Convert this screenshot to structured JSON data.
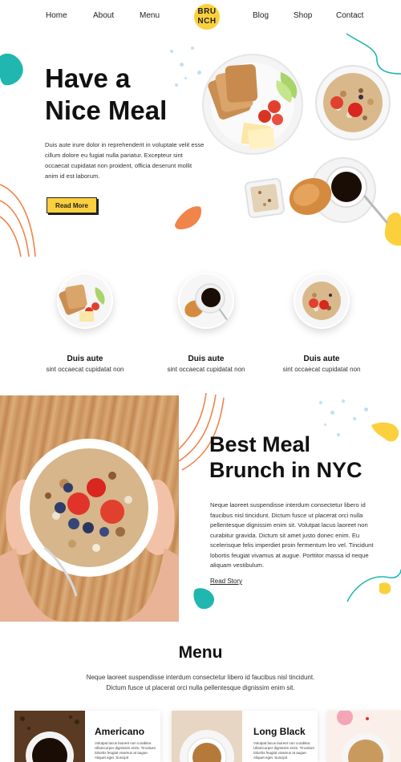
{
  "nav": {
    "items": [
      "Home",
      "About",
      "Menu",
      "Blog",
      "Shop",
      "Contact"
    ],
    "logo_line1": "BRU",
    "logo_line2": "NCH"
  },
  "hero": {
    "title_line1": "Have a",
    "title_line2": "Nice Meal",
    "text": "Duis aute irure dolor in reprehenderit in voluptate velit esse cillum dolore eu fugiat nulla pariatur. Excepteur sint occaecat cupidatat non proident, officia deserunt mollit anim id est laborum.",
    "button": "Read More"
  },
  "features": [
    {
      "title": "Duis aute",
      "sub": "sint occaecat cupidatat non",
      "icon": "toast-plate-icon"
    },
    {
      "title": "Duis aute",
      "sub": "sint occaecat cupidatat non",
      "icon": "coffee-cup-icon"
    },
    {
      "title": "Duis aute",
      "sub": "sint occaecat cupidatat non",
      "icon": "granola-bowl-icon"
    }
  ],
  "brunch": {
    "title_line1": "Best Meal",
    "title_line2": "Brunch in NYC",
    "text": "Neque laoreet suspendisse interdum consectetur libero id faucibus nisl tincidunt. Dictum fusce ut placerat orci nulla pellentesque dignissim enim sit. Volutpat lacus laoreet non curabitur gravida. Dictum sit amet justo donec enim. Eu scelerisque felis imperdiet proin fermentum leo vel. Tincidunt lobortis feugiat vivamus at augue. Porttitor massa id neque aliquam vestibulum.",
    "link": "Read Story"
  },
  "menu": {
    "title": "Menu",
    "text": "Neque laoreet suspendisse interdum consectetur libero id faucibus nisl tincidunt. Dictum fusce ut placerat orci nulla pellentesque dignissim enim sit.",
    "cards": [
      {
        "title": "Americano",
        "desc": "Volutpat lacus laoreet non curabitur. Ullamcorper dignissim enim. Tincidunt lobortis feugiat vivamus at augue. Aliquet eget. Suscipit"
      },
      {
        "title": "Long Black",
        "desc": "Volutpat lacus laoreet non curabitur. Ullamcorper dignissim enim. Tincidunt lobortis feugiat vivamus at augue. Aliquet eget. Suscipit"
      }
    ]
  },
  "colors": {
    "accent_yellow": "#fbd03c",
    "accent_teal": "#1fb7b0",
    "accent_orange": "#f0844a",
    "light_blue": "#bde1f3"
  }
}
